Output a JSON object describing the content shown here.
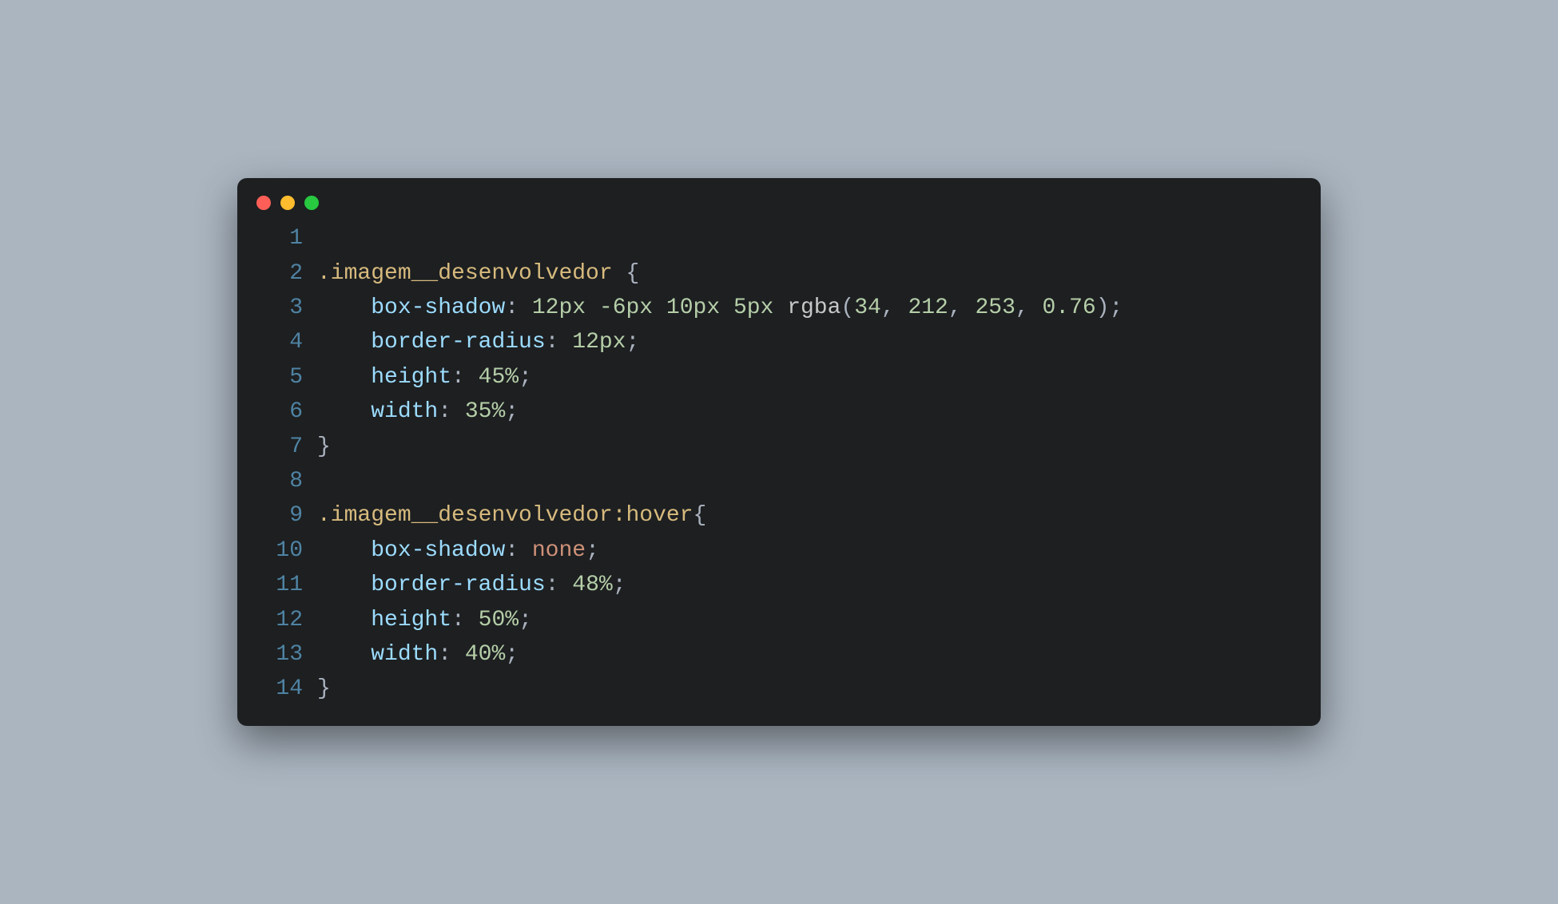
{
  "window": {
    "traffic_lights": [
      "close",
      "minimize",
      "zoom"
    ]
  },
  "code": {
    "lines": [
      {
        "n": "1",
        "tokens": []
      },
      {
        "n": "2",
        "tokens": [
          {
            "c": "tk-sel",
            "t": ".imagem__desenvolvedor "
          },
          {
            "c": "tk-brace",
            "t": "{"
          }
        ]
      },
      {
        "n": "3",
        "tokens": [
          {
            "c": "tk-default",
            "t": "    "
          },
          {
            "c": "tk-prop",
            "t": "box-shadow"
          },
          {
            "c": "tk-colon",
            "t": ": "
          },
          {
            "c": "tk-num",
            "t": "12px"
          },
          {
            "c": "tk-default",
            "t": " "
          },
          {
            "c": "tk-num",
            "t": "-6px"
          },
          {
            "c": "tk-default",
            "t": " "
          },
          {
            "c": "tk-num",
            "t": "10px"
          },
          {
            "c": "tk-default",
            "t": " "
          },
          {
            "c": "tk-num",
            "t": "5px"
          },
          {
            "c": "tk-default",
            "t": " "
          },
          {
            "c": "tk-func",
            "t": "rgba"
          },
          {
            "c": "tk-paren",
            "t": "("
          },
          {
            "c": "tk-num",
            "t": "34"
          },
          {
            "c": "tk-comma",
            "t": ", "
          },
          {
            "c": "tk-num",
            "t": "212"
          },
          {
            "c": "tk-comma",
            "t": ", "
          },
          {
            "c": "tk-num",
            "t": "253"
          },
          {
            "c": "tk-comma",
            "t": ", "
          },
          {
            "c": "tk-num",
            "t": "0.76"
          },
          {
            "c": "tk-paren",
            "t": ")"
          },
          {
            "c": "tk-semi",
            "t": ";"
          }
        ]
      },
      {
        "n": "4",
        "tokens": [
          {
            "c": "tk-default",
            "t": "    "
          },
          {
            "c": "tk-prop",
            "t": "border-radius"
          },
          {
            "c": "tk-colon",
            "t": ": "
          },
          {
            "c": "tk-num",
            "t": "12px"
          },
          {
            "c": "tk-semi",
            "t": ";"
          }
        ]
      },
      {
        "n": "5",
        "tokens": [
          {
            "c": "tk-default",
            "t": "    "
          },
          {
            "c": "tk-prop",
            "t": "height"
          },
          {
            "c": "tk-colon",
            "t": ": "
          },
          {
            "c": "tk-num",
            "t": "45%"
          },
          {
            "c": "tk-semi",
            "t": ";"
          }
        ]
      },
      {
        "n": "6",
        "tokens": [
          {
            "c": "tk-default",
            "t": "    "
          },
          {
            "c": "tk-prop",
            "t": "width"
          },
          {
            "c": "tk-colon",
            "t": ": "
          },
          {
            "c": "tk-num",
            "t": "35%"
          },
          {
            "c": "tk-semi",
            "t": ";"
          }
        ]
      },
      {
        "n": "7",
        "tokens": [
          {
            "c": "tk-brace",
            "t": "}"
          }
        ]
      },
      {
        "n": "8",
        "tokens": []
      },
      {
        "n": "9",
        "tokens": [
          {
            "c": "tk-sel",
            "t": ".imagem__desenvolvedor"
          },
          {
            "c": "tk-pseudo",
            "t": ":hover"
          },
          {
            "c": "tk-brace",
            "t": "{"
          }
        ]
      },
      {
        "n": "10",
        "tokens": [
          {
            "c": "tk-default",
            "t": "    "
          },
          {
            "c": "tk-prop",
            "t": "box-shadow"
          },
          {
            "c": "tk-colon",
            "t": ": "
          },
          {
            "c": "tk-none",
            "t": "none"
          },
          {
            "c": "tk-semi",
            "t": ";"
          }
        ]
      },
      {
        "n": "11",
        "tokens": [
          {
            "c": "tk-default",
            "t": "    "
          },
          {
            "c": "tk-prop",
            "t": "border-radius"
          },
          {
            "c": "tk-colon",
            "t": ": "
          },
          {
            "c": "tk-num",
            "t": "48%"
          },
          {
            "c": "tk-semi",
            "t": ";"
          }
        ]
      },
      {
        "n": "12",
        "tokens": [
          {
            "c": "tk-default",
            "t": "    "
          },
          {
            "c": "tk-prop",
            "t": "height"
          },
          {
            "c": "tk-colon",
            "t": ": "
          },
          {
            "c": "tk-num",
            "t": "50%"
          },
          {
            "c": "tk-semi",
            "t": ";"
          }
        ]
      },
      {
        "n": "13",
        "tokens": [
          {
            "c": "tk-default",
            "t": "    "
          },
          {
            "c": "tk-prop",
            "t": "width"
          },
          {
            "c": "tk-colon",
            "t": ": "
          },
          {
            "c": "tk-num",
            "t": "40%"
          },
          {
            "c": "tk-semi",
            "t": ";"
          }
        ]
      },
      {
        "n": "14",
        "tokens": [
          {
            "c": "tk-brace",
            "t": "}"
          }
        ]
      }
    ]
  }
}
